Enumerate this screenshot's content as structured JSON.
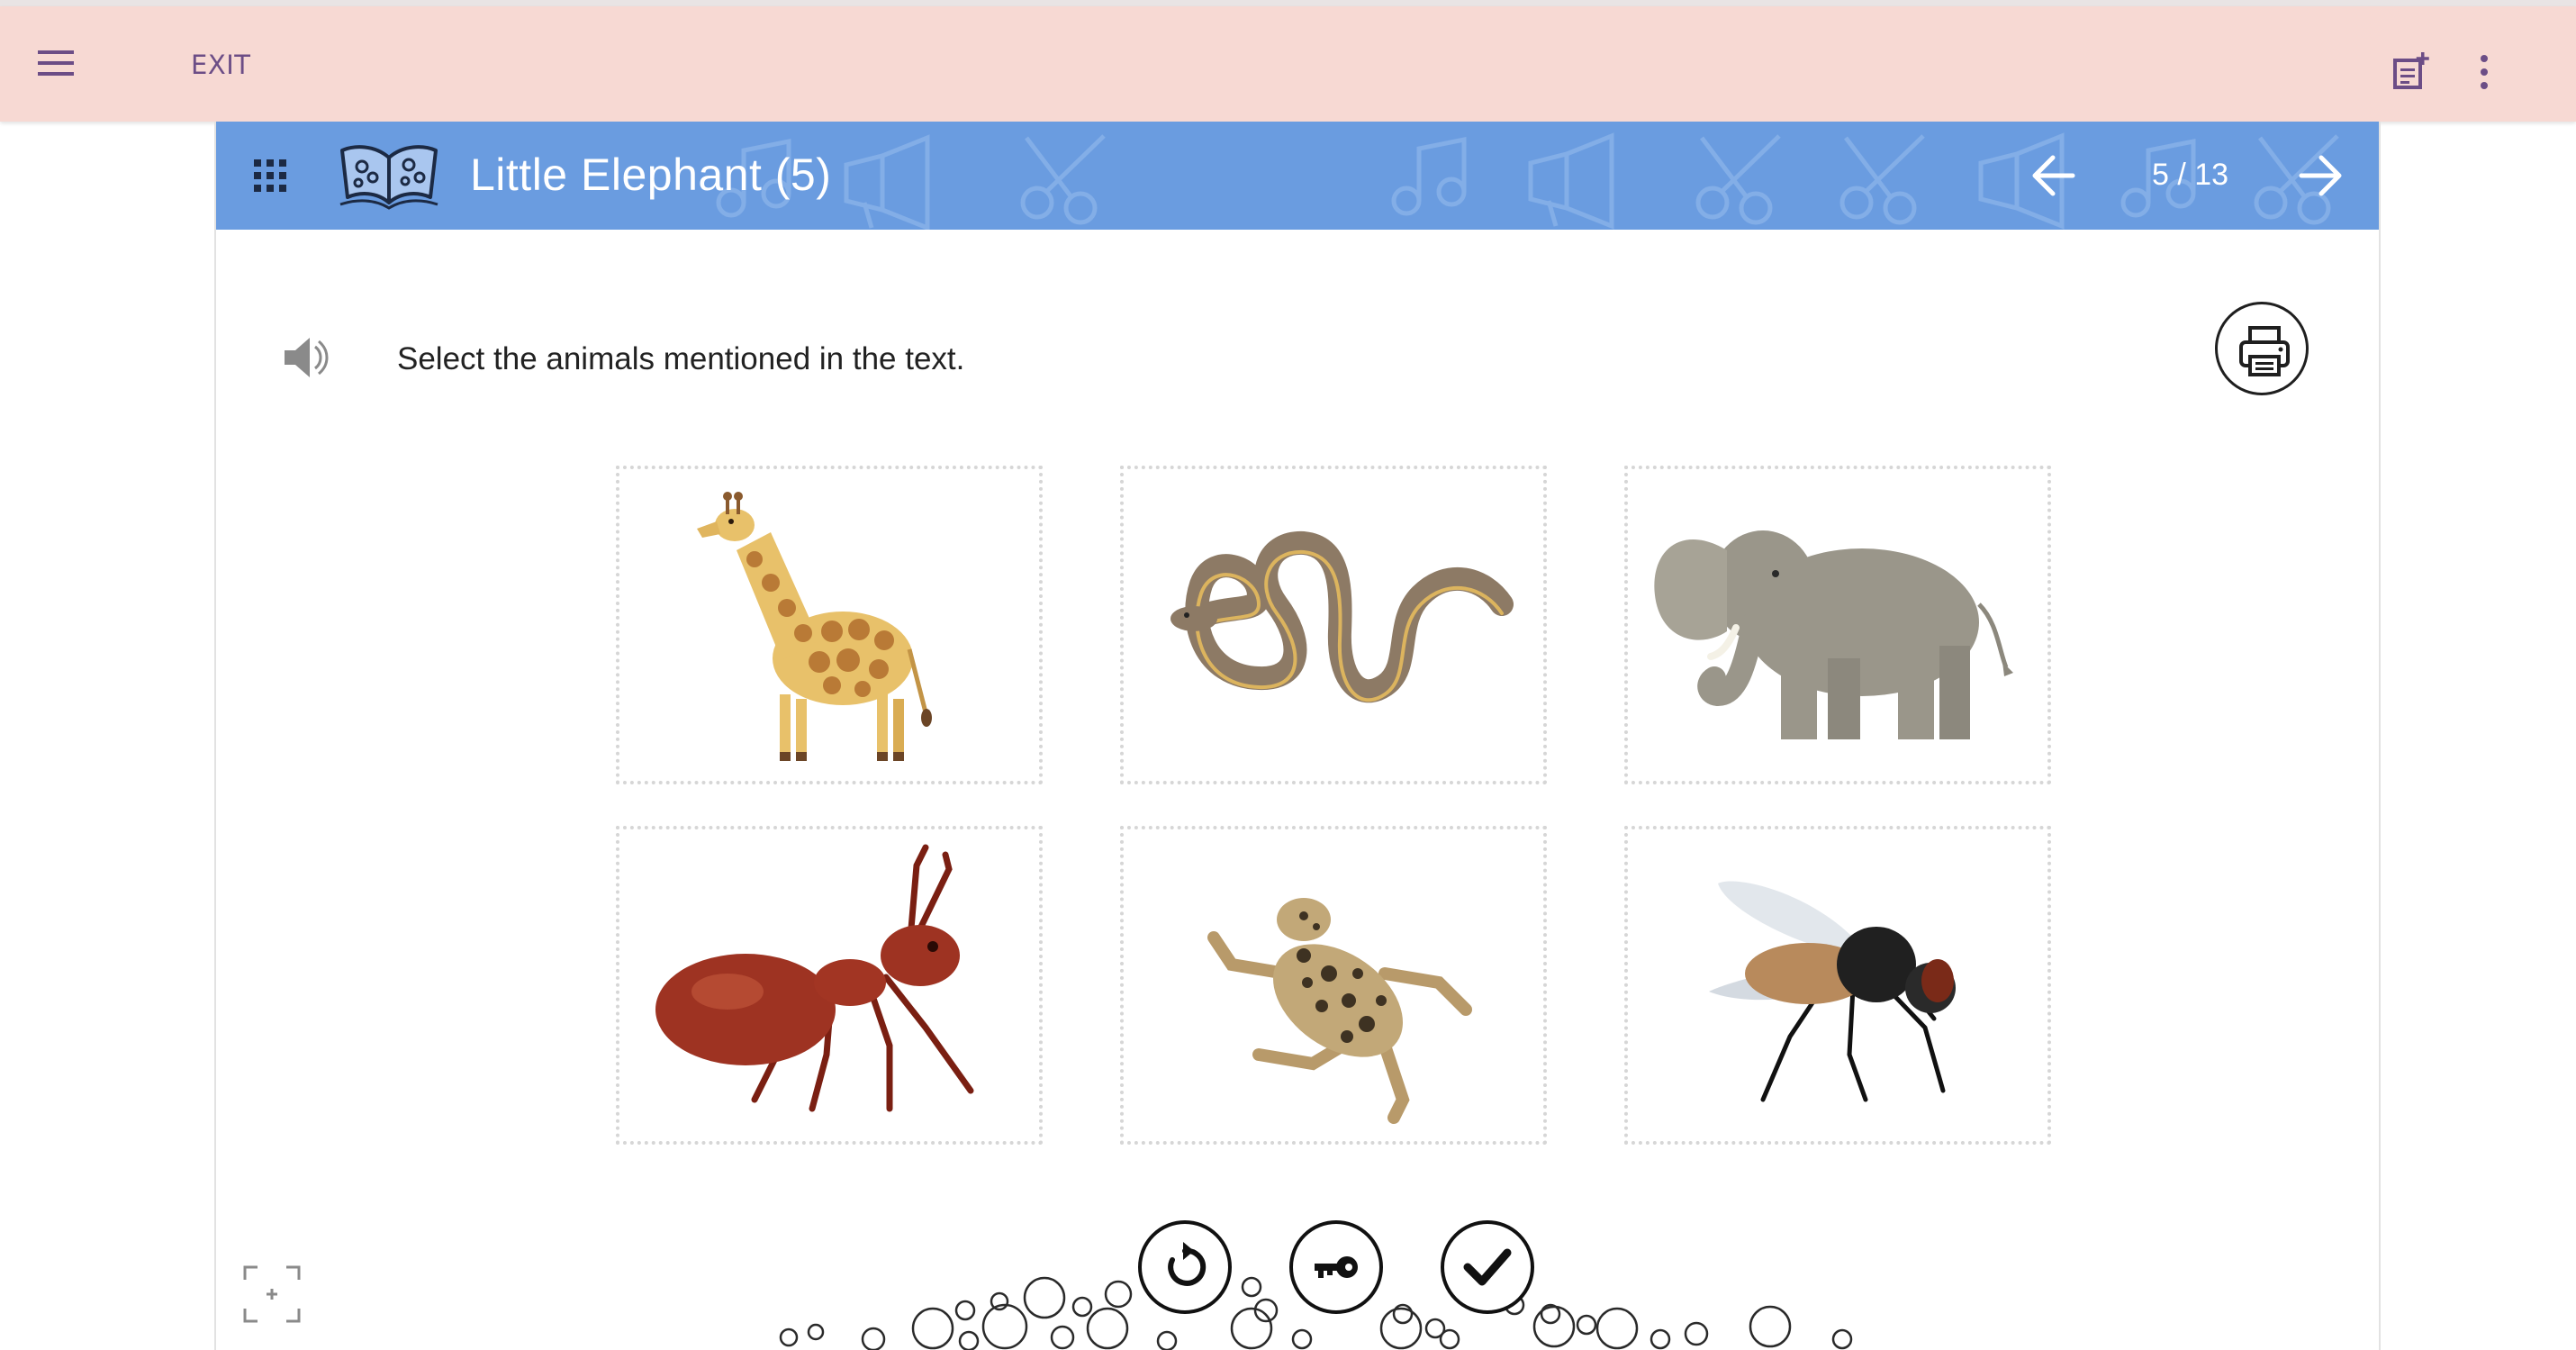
{
  "appbar": {
    "menu_icon": "hamburger-icon",
    "exit_label": "EXIT",
    "note_icon": "note-add-icon",
    "more_icon": "more-vertical-icon",
    "background_color": "#f7d9d3",
    "exit_color": "#6c4d86"
  },
  "banner": {
    "title": "Little Elephant (5)",
    "page_counter": "5 / 13",
    "background_color": "#6a9ce0",
    "grid_icon": "apps-grid-icon",
    "book_icon": "open-book-icon",
    "prev_icon": "arrow-left-icon",
    "next_icon": "arrow-right-icon"
  },
  "exercise": {
    "instruction": "Select the animals mentioned in the text.",
    "speaker_icon": "speaker-icon",
    "print_icon": "printer-icon",
    "choices": [
      {
        "id": "giraffe",
        "icon": "giraffe-image"
      },
      {
        "id": "snake",
        "icon": "snake-image"
      },
      {
        "id": "elephant",
        "icon": "elephant-image"
      },
      {
        "id": "ant",
        "icon": "ant-image"
      },
      {
        "id": "frog",
        "icon": "frog-image"
      },
      {
        "id": "fly",
        "icon": "fly-image"
      }
    ]
  },
  "controls": {
    "reset_icon": "reset-icon",
    "key_icon": "key-icon",
    "check_icon": "check-icon",
    "fullscreen_icon": "fullscreen-icon"
  }
}
